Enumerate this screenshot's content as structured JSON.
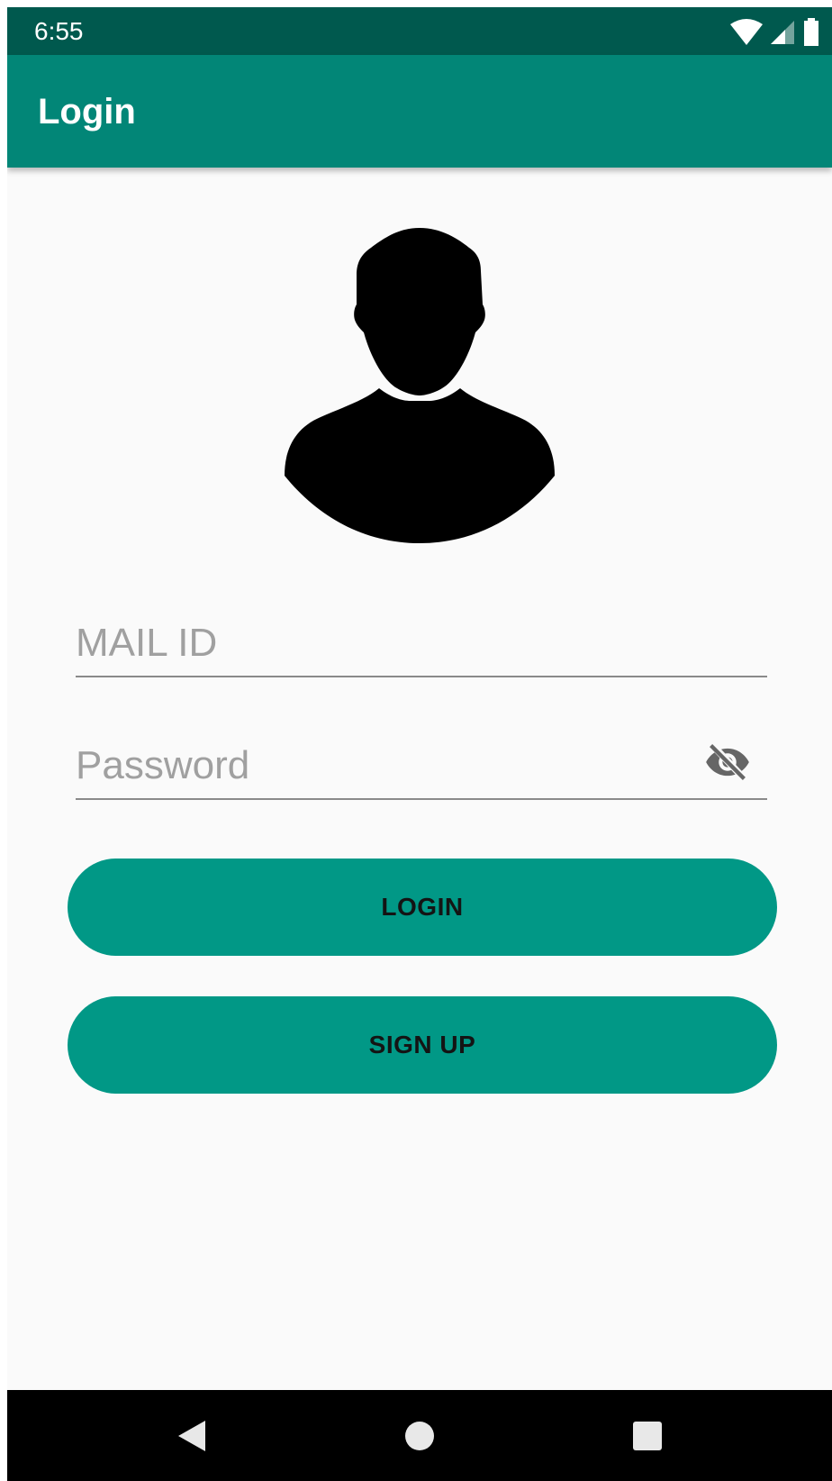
{
  "status_bar": {
    "time": "6:55",
    "icons": [
      "wifi-icon",
      "cellular-signal-icon",
      "battery-icon"
    ]
  },
  "app_bar": {
    "title": "Login",
    "color": "#028677",
    "status_color": "#00594e"
  },
  "avatar": {
    "icon": "person-silhouette-icon"
  },
  "form": {
    "mail": {
      "placeholder": "MAIL ID",
      "value": ""
    },
    "password": {
      "placeholder": "Password",
      "value": "",
      "toggle_icon": "visibility-off-icon"
    }
  },
  "buttons": {
    "login_label": "LOGIN",
    "signup_label": "SIGN UP",
    "color": "#019886"
  },
  "nav_bar": {
    "icons": [
      "back-icon",
      "home-icon",
      "recents-icon"
    ]
  }
}
